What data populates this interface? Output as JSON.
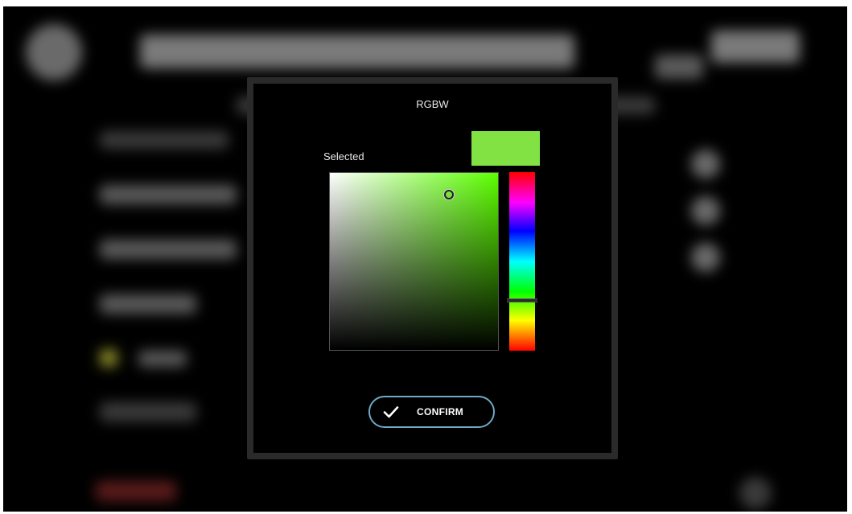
{
  "dialog": {
    "title": "RGBW",
    "selected_label": "Selected",
    "selected_color": "#82e244",
    "hue_color": "#5cff00",
    "hue_position": 0.72,
    "saturation": 0.7,
    "brightness": 0.88,
    "confirm_label": "CONFIRM",
    "confirm_border_color": "#6fa9c6"
  },
  "icons": {
    "confirm": "checkmark-icon"
  }
}
